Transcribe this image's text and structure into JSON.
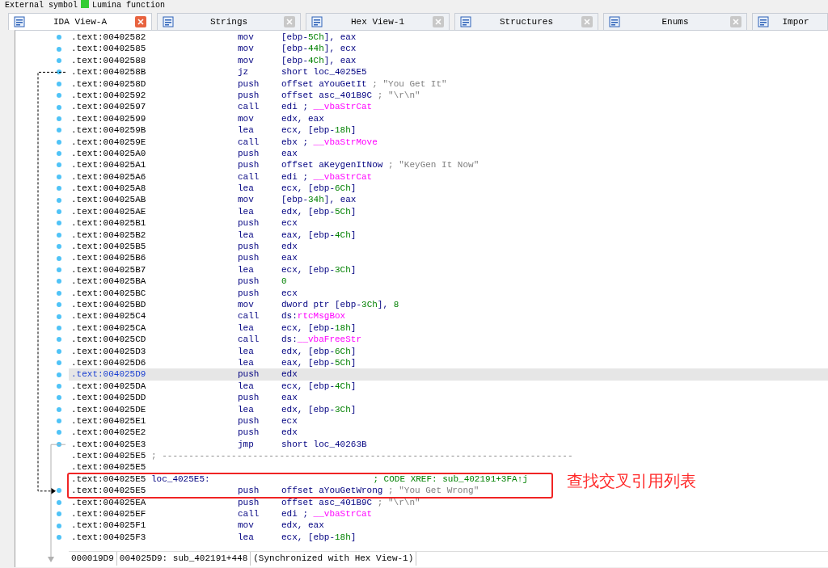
{
  "legend": [
    {
      "text": "External symbol"
    },
    {
      "text": "Lumina function",
      "color": "#33cc33"
    }
  ],
  "tabs": [
    {
      "label": "IDA View-A",
      "selected": true,
      "closable": true
    },
    {
      "label": "Strings",
      "selected": false,
      "closable": true
    },
    {
      "label": "Hex View-1",
      "selected": false,
      "closable": true
    },
    {
      "label": "Structures",
      "selected": false,
      "closable": true
    },
    {
      "label": "Enums",
      "selected": false,
      "closable": true
    },
    {
      "label": "Impor",
      "selected": false,
      "closable": false
    }
  ],
  "lines": [
    {
      "kind": "instruction",
      "address": ".text:00402582",
      "mnemonic": "mov",
      "operands": [
        {
          "text": "[ebp-",
          "kind": "plain"
        },
        {
          "text": "5Ch",
          "kind": "number"
        },
        {
          "text": "], eax",
          "kind": "plain"
        }
      ],
      "dot": true,
      "selected": false
    },
    {
      "kind": "instruction",
      "address": ".text:00402585",
      "mnemonic": "mov",
      "operands": [
        {
          "text": "[ebp-",
          "kind": "plain"
        },
        {
          "text": "44h",
          "kind": "number"
        },
        {
          "text": "], ecx",
          "kind": "plain"
        }
      ],
      "dot": true,
      "selected": false
    },
    {
      "kind": "instruction",
      "address": ".text:00402588",
      "mnemonic": "mov",
      "operands": [
        {
          "text": "[ebp-",
          "kind": "plain"
        },
        {
          "text": "4Ch",
          "kind": "number"
        },
        {
          "text": "], eax",
          "kind": "plain"
        }
      ],
      "dot": true,
      "selected": false
    },
    {
      "kind": "instruction",
      "address": ".text:0040258B",
      "mnemonic": "jz",
      "operands": [
        {
          "text": "short loc_4025E5",
          "kind": "plain"
        }
      ],
      "dot": true,
      "selected": false,
      "jump_source": true
    },
    {
      "kind": "instruction",
      "address": ".text:0040258D",
      "mnemonic": "push",
      "operands": [
        {
          "text": "offset aYouGetIt",
          "kind": "plain"
        },
        {
          "text": " ; \"You Get It\"",
          "kind": "comment"
        }
      ],
      "dot": true,
      "selected": false
    },
    {
      "kind": "instruction",
      "address": ".text:00402592",
      "mnemonic": "push",
      "operands": [
        {
          "text": "offset asc_401B9C",
          "kind": "plain"
        },
        {
          "text": " ; \"\\r\\n\"",
          "kind": "comment"
        }
      ],
      "dot": true,
      "selected": false
    },
    {
      "kind": "instruction",
      "address": ".text:00402597",
      "mnemonic": "call",
      "operands": [
        {
          "text": "edi ; ",
          "kind": "plain"
        },
        {
          "text": "__vbaStrCat",
          "kind": "import"
        }
      ],
      "dot": true,
      "selected": false
    },
    {
      "kind": "instruction",
      "address": ".text:00402599",
      "mnemonic": "mov",
      "operands": [
        {
          "text": "edx, eax",
          "kind": "plain"
        }
      ],
      "dot": true,
      "selected": false
    },
    {
      "kind": "instruction",
      "address": ".text:0040259B",
      "mnemonic": "lea",
      "operands": [
        {
          "text": "ecx, [ebp-",
          "kind": "plain"
        },
        {
          "text": "18h",
          "kind": "number"
        },
        {
          "text": "]",
          "kind": "plain"
        }
      ],
      "dot": true,
      "selected": false
    },
    {
      "kind": "instruction",
      "address": ".text:0040259E",
      "mnemonic": "call",
      "operands": [
        {
          "text": "ebx ; ",
          "kind": "plain"
        },
        {
          "text": "__vbaStrMove",
          "kind": "import"
        }
      ],
      "dot": true,
      "selected": false
    },
    {
      "kind": "instruction",
      "address": ".text:004025A0",
      "mnemonic": "push",
      "operands": [
        {
          "text": "eax",
          "kind": "plain"
        }
      ],
      "dot": true,
      "selected": false
    },
    {
      "kind": "instruction",
      "address": ".text:004025A1",
      "mnemonic": "push",
      "operands": [
        {
          "text": "offset aKeygenItNow",
          "kind": "plain"
        },
        {
          "text": " ; \"KeyGen It Now\"",
          "kind": "comment"
        }
      ],
      "dot": true,
      "selected": false
    },
    {
      "kind": "instruction",
      "address": ".text:004025A6",
      "mnemonic": "call",
      "operands": [
        {
          "text": "edi ; ",
          "kind": "plain"
        },
        {
          "text": "__vbaStrCat",
          "kind": "import"
        }
      ],
      "dot": true,
      "selected": false
    },
    {
      "kind": "instruction",
      "address": ".text:004025A8",
      "mnemonic": "lea",
      "operands": [
        {
          "text": "ecx, [ebp-",
          "kind": "plain"
        },
        {
          "text": "6Ch",
          "kind": "number"
        },
        {
          "text": "]",
          "kind": "plain"
        }
      ],
      "dot": true,
      "selected": false
    },
    {
      "kind": "instruction",
      "address": ".text:004025AB",
      "mnemonic": "mov",
      "operands": [
        {
          "text": "[ebp-",
          "kind": "plain"
        },
        {
          "text": "34h",
          "kind": "number"
        },
        {
          "text": "], eax",
          "kind": "plain"
        }
      ],
      "dot": true,
      "selected": false
    },
    {
      "kind": "instruction",
      "address": ".text:004025AE",
      "mnemonic": "lea",
      "operands": [
        {
          "text": "edx, [ebp-",
          "kind": "plain"
        },
        {
          "text": "5Ch",
          "kind": "number"
        },
        {
          "text": "]",
          "kind": "plain"
        }
      ],
      "dot": true,
      "selected": false
    },
    {
      "kind": "instruction",
      "address": ".text:004025B1",
      "mnemonic": "push",
      "operands": [
        {
          "text": "ecx",
          "kind": "plain"
        }
      ],
      "dot": true,
      "selected": false
    },
    {
      "kind": "instruction",
      "address": ".text:004025B2",
      "mnemonic": "lea",
      "operands": [
        {
          "text": "eax, [ebp-",
          "kind": "plain"
        },
        {
          "text": "4Ch",
          "kind": "number"
        },
        {
          "text": "]",
          "kind": "plain"
        }
      ],
      "dot": true,
      "selected": false
    },
    {
      "kind": "instruction",
      "address": ".text:004025B5",
      "mnemonic": "push",
      "operands": [
        {
          "text": "edx",
          "kind": "plain"
        }
      ],
      "dot": true,
      "selected": false
    },
    {
      "kind": "instruction",
      "address": ".text:004025B6",
      "mnemonic": "push",
      "operands": [
        {
          "text": "eax",
          "kind": "plain"
        }
      ],
      "dot": true,
      "selected": false
    },
    {
      "kind": "instruction",
      "address": ".text:004025B7",
      "mnemonic": "lea",
      "operands": [
        {
          "text": "ecx, [ebp-",
          "kind": "plain"
        },
        {
          "text": "3Ch",
          "kind": "number"
        },
        {
          "text": "]",
          "kind": "plain"
        }
      ],
      "dot": true,
      "selected": false
    },
    {
      "kind": "instruction",
      "address": ".text:004025BA",
      "mnemonic": "push",
      "operands": [
        {
          "text": "0",
          "kind": "number"
        }
      ],
      "dot": true,
      "selected": false
    },
    {
      "kind": "instruction",
      "address": ".text:004025BC",
      "mnemonic": "push",
      "operands": [
        {
          "text": "ecx",
          "kind": "plain"
        }
      ],
      "dot": true,
      "selected": false
    },
    {
      "kind": "instruction",
      "address": ".text:004025BD",
      "mnemonic": "mov",
      "operands": [
        {
          "text": "dword ptr [ebp-",
          "kind": "plain"
        },
        {
          "text": "3Ch",
          "kind": "number"
        },
        {
          "text": "], ",
          "kind": "plain"
        },
        {
          "text": "8",
          "kind": "number"
        }
      ],
      "dot": true,
      "selected": false
    },
    {
      "kind": "instruction",
      "address": ".text:004025C4",
      "mnemonic": "call",
      "operands": [
        {
          "text": "ds:",
          "kind": "plain"
        },
        {
          "text": "rtcMsgBox",
          "kind": "import"
        }
      ],
      "dot": true,
      "selected": false
    },
    {
      "kind": "instruction",
      "address": ".text:004025CA",
      "mnemonic": "lea",
      "operands": [
        {
          "text": "ecx, [ebp-",
          "kind": "plain"
        },
        {
          "text": "18h",
          "kind": "number"
        },
        {
          "text": "]",
          "kind": "plain"
        }
      ],
      "dot": true,
      "selected": false
    },
    {
      "kind": "instruction",
      "address": ".text:004025CD",
      "mnemonic": "call",
      "operands": [
        {
          "text": "ds:",
          "kind": "plain"
        },
        {
          "text": "__vbaFreeStr",
          "kind": "import"
        }
      ],
      "dot": true,
      "selected": false
    },
    {
      "kind": "instruction",
      "address": ".text:004025D3",
      "mnemonic": "lea",
      "operands": [
        {
          "text": "edx, [ebp-",
          "kind": "plain"
        },
        {
          "text": "6Ch",
          "kind": "number"
        },
        {
          "text": "]",
          "kind": "plain"
        }
      ],
      "dot": true,
      "selected": false
    },
    {
      "kind": "instruction",
      "address": ".text:004025D6",
      "mnemonic": "lea",
      "operands": [
        {
          "text": "eax, [ebp-",
          "kind": "plain"
        },
        {
          "text": "5Ch",
          "kind": "number"
        },
        {
          "text": "]",
          "kind": "plain"
        }
      ],
      "dot": true,
      "selected": false
    },
    {
      "kind": "instruction",
      "address": ".text:004025D9",
      "mnemonic": "push",
      "operands": [
        {
          "text": "edx",
          "kind": "plain"
        }
      ],
      "dot": true,
      "selected": true
    },
    {
      "kind": "instruction",
      "address": ".text:004025DA",
      "mnemonic": "lea",
      "operands": [
        {
          "text": "ecx, [ebp-",
          "kind": "plain"
        },
        {
          "text": "4Ch",
          "kind": "number"
        },
        {
          "text": "]",
          "kind": "plain"
        }
      ],
      "dot": true,
      "selected": false
    },
    {
      "kind": "instruction",
      "address": ".text:004025DD",
      "mnemonic": "push",
      "operands": [
        {
          "text": "eax",
          "kind": "plain"
        }
      ],
      "dot": true,
      "selected": false
    },
    {
      "kind": "instruction",
      "address": ".text:004025DE",
      "mnemonic": "lea",
      "operands": [
        {
          "text": "edx, [ebp-",
          "kind": "plain"
        },
        {
          "text": "3Ch",
          "kind": "number"
        },
        {
          "text": "]",
          "kind": "plain"
        }
      ],
      "dot": true,
      "selected": false
    },
    {
      "kind": "instruction",
      "address": ".text:004025E1",
      "mnemonic": "push",
      "operands": [
        {
          "text": "ecx",
          "kind": "plain"
        }
      ],
      "dot": true,
      "selected": false
    },
    {
      "kind": "instruction",
      "address": ".text:004025E2",
      "mnemonic": "push",
      "operands": [
        {
          "text": "edx",
          "kind": "plain"
        }
      ],
      "dot": true,
      "selected": false
    },
    {
      "kind": "instruction",
      "address": ".text:004025E3",
      "mnemonic": "jmp",
      "operands": [
        {
          "text": "short loc_40263B",
          "kind": "plain"
        }
      ],
      "dot": true,
      "selected": false,
      "flow_out": true
    },
    {
      "kind": "separator",
      "address": ".text:004025E5",
      "text": "; -----------------------------------------------------------------------------",
      "dot": false,
      "selected": false
    },
    {
      "kind": "blank",
      "address": ".text:004025E5",
      "dot": false,
      "selected": false
    },
    {
      "kind": "label",
      "address": ".text:004025E5",
      "label": "loc_4025E5:",
      "comment": "; CODE XREF: sub_402191+3FA↑j",
      "dot": false,
      "selected": false
    },
    {
      "kind": "instruction",
      "address": ".text:004025E5",
      "mnemonic": "push",
      "operands": [
        {
          "text": "offset aYouGetWrong",
          "kind": "plain"
        },
        {
          "text": " ; \"You Get Wrong\"",
          "kind": "comment"
        }
      ],
      "dot": true,
      "selected": false,
      "jump_target": true
    },
    {
      "kind": "instruction",
      "address": ".text:004025EA",
      "mnemonic": "push",
      "operands": [
        {
          "text": "offset asc_401B9C",
          "kind": "plain"
        },
        {
          "text": " ; \"\\r\\n\"",
          "kind": "comment"
        }
      ],
      "dot": true,
      "selected": false
    },
    {
      "kind": "instruction",
      "address": ".text:004025EF",
      "mnemonic": "call",
      "operands": [
        {
          "text": "edi ; ",
          "kind": "plain"
        },
        {
          "text": "__vbaStrCat",
          "kind": "import"
        }
      ],
      "dot": true,
      "selected": false
    },
    {
      "kind": "instruction",
      "address": ".text:004025F1",
      "mnemonic": "mov",
      "operands": [
        {
          "text": "edx, eax",
          "kind": "plain"
        }
      ],
      "dot": true,
      "selected": false
    },
    {
      "kind": "instruction",
      "address": ".text:004025F3",
      "mnemonic": "lea",
      "operands": [
        {
          "text": "ecx, [ebp-",
          "kind": "plain"
        },
        {
          "text": "18h",
          "kind": "number"
        },
        {
          "text": "]",
          "kind": "plain"
        }
      ],
      "dot": true,
      "selected": false
    }
  ],
  "status_bar": [
    "000019D9",
    "004025D9: sub_402191+448",
    "(Synchronized with Hex View-1)"
  ],
  "annotation": {
    "text": "查找交叉引用列表"
  }
}
